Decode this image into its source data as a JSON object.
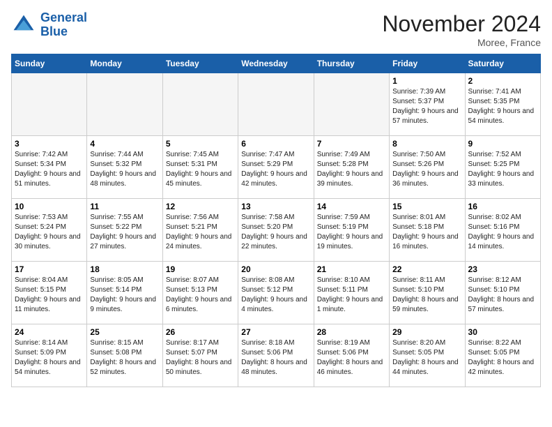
{
  "header": {
    "logo_line1": "General",
    "logo_line2": "Blue",
    "month_year": "November 2024",
    "location": "Moree, France"
  },
  "weekdays": [
    "Sunday",
    "Monday",
    "Tuesday",
    "Wednesday",
    "Thursday",
    "Friday",
    "Saturday"
  ],
  "weeks": [
    [
      {
        "day": null
      },
      {
        "day": null
      },
      {
        "day": null
      },
      {
        "day": null
      },
      {
        "day": null
      },
      {
        "day": 1,
        "sunrise": "Sunrise: 7:39 AM",
        "sunset": "Sunset: 5:37 PM",
        "daylight": "Daylight: 9 hours and 57 minutes."
      },
      {
        "day": 2,
        "sunrise": "Sunrise: 7:41 AM",
        "sunset": "Sunset: 5:35 PM",
        "daylight": "Daylight: 9 hours and 54 minutes."
      }
    ],
    [
      {
        "day": 3,
        "sunrise": "Sunrise: 7:42 AM",
        "sunset": "Sunset: 5:34 PM",
        "daylight": "Daylight: 9 hours and 51 minutes."
      },
      {
        "day": 4,
        "sunrise": "Sunrise: 7:44 AM",
        "sunset": "Sunset: 5:32 PM",
        "daylight": "Daylight: 9 hours and 48 minutes."
      },
      {
        "day": 5,
        "sunrise": "Sunrise: 7:45 AM",
        "sunset": "Sunset: 5:31 PM",
        "daylight": "Daylight: 9 hours and 45 minutes."
      },
      {
        "day": 6,
        "sunrise": "Sunrise: 7:47 AM",
        "sunset": "Sunset: 5:29 PM",
        "daylight": "Daylight: 9 hours and 42 minutes."
      },
      {
        "day": 7,
        "sunrise": "Sunrise: 7:49 AM",
        "sunset": "Sunset: 5:28 PM",
        "daylight": "Daylight: 9 hours and 39 minutes."
      },
      {
        "day": 8,
        "sunrise": "Sunrise: 7:50 AM",
        "sunset": "Sunset: 5:26 PM",
        "daylight": "Daylight: 9 hours and 36 minutes."
      },
      {
        "day": 9,
        "sunrise": "Sunrise: 7:52 AM",
        "sunset": "Sunset: 5:25 PM",
        "daylight": "Daylight: 9 hours and 33 minutes."
      }
    ],
    [
      {
        "day": 10,
        "sunrise": "Sunrise: 7:53 AM",
        "sunset": "Sunset: 5:24 PM",
        "daylight": "Daylight: 9 hours and 30 minutes."
      },
      {
        "day": 11,
        "sunrise": "Sunrise: 7:55 AM",
        "sunset": "Sunset: 5:22 PM",
        "daylight": "Daylight: 9 hours and 27 minutes."
      },
      {
        "day": 12,
        "sunrise": "Sunrise: 7:56 AM",
        "sunset": "Sunset: 5:21 PM",
        "daylight": "Daylight: 9 hours and 24 minutes."
      },
      {
        "day": 13,
        "sunrise": "Sunrise: 7:58 AM",
        "sunset": "Sunset: 5:20 PM",
        "daylight": "Daylight: 9 hours and 22 minutes."
      },
      {
        "day": 14,
        "sunrise": "Sunrise: 7:59 AM",
        "sunset": "Sunset: 5:19 PM",
        "daylight": "Daylight: 9 hours and 19 minutes."
      },
      {
        "day": 15,
        "sunrise": "Sunrise: 8:01 AM",
        "sunset": "Sunset: 5:18 PM",
        "daylight": "Daylight: 9 hours and 16 minutes."
      },
      {
        "day": 16,
        "sunrise": "Sunrise: 8:02 AM",
        "sunset": "Sunset: 5:16 PM",
        "daylight": "Daylight: 9 hours and 14 minutes."
      }
    ],
    [
      {
        "day": 17,
        "sunrise": "Sunrise: 8:04 AM",
        "sunset": "Sunset: 5:15 PM",
        "daylight": "Daylight: 9 hours and 11 minutes."
      },
      {
        "day": 18,
        "sunrise": "Sunrise: 8:05 AM",
        "sunset": "Sunset: 5:14 PM",
        "daylight": "Daylight: 9 hours and 9 minutes."
      },
      {
        "day": 19,
        "sunrise": "Sunrise: 8:07 AM",
        "sunset": "Sunset: 5:13 PM",
        "daylight": "Daylight: 9 hours and 6 minutes."
      },
      {
        "day": 20,
        "sunrise": "Sunrise: 8:08 AM",
        "sunset": "Sunset: 5:12 PM",
        "daylight": "Daylight: 9 hours and 4 minutes."
      },
      {
        "day": 21,
        "sunrise": "Sunrise: 8:10 AM",
        "sunset": "Sunset: 5:11 PM",
        "daylight": "Daylight: 9 hours and 1 minute."
      },
      {
        "day": 22,
        "sunrise": "Sunrise: 8:11 AM",
        "sunset": "Sunset: 5:10 PM",
        "daylight": "Daylight: 8 hours and 59 minutes."
      },
      {
        "day": 23,
        "sunrise": "Sunrise: 8:12 AM",
        "sunset": "Sunset: 5:10 PM",
        "daylight": "Daylight: 8 hours and 57 minutes."
      }
    ],
    [
      {
        "day": 24,
        "sunrise": "Sunrise: 8:14 AM",
        "sunset": "Sunset: 5:09 PM",
        "daylight": "Daylight: 8 hours and 54 minutes."
      },
      {
        "day": 25,
        "sunrise": "Sunrise: 8:15 AM",
        "sunset": "Sunset: 5:08 PM",
        "daylight": "Daylight: 8 hours and 52 minutes."
      },
      {
        "day": 26,
        "sunrise": "Sunrise: 8:17 AM",
        "sunset": "Sunset: 5:07 PM",
        "daylight": "Daylight: 8 hours and 50 minutes."
      },
      {
        "day": 27,
        "sunrise": "Sunrise: 8:18 AM",
        "sunset": "Sunset: 5:06 PM",
        "daylight": "Daylight: 8 hours and 48 minutes."
      },
      {
        "day": 28,
        "sunrise": "Sunrise: 8:19 AM",
        "sunset": "Sunset: 5:06 PM",
        "daylight": "Daylight: 8 hours and 46 minutes."
      },
      {
        "day": 29,
        "sunrise": "Sunrise: 8:20 AM",
        "sunset": "Sunset: 5:05 PM",
        "daylight": "Daylight: 8 hours and 44 minutes."
      },
      {
        "day": 30,
        "sunrise": "Sunrise: 8:22 AM",
        "sunset": "Sunset: 5:05 PM",
        "daylight": "Daylight: 8 hours and 42 minutes."
      }
    ]
  ]
}
